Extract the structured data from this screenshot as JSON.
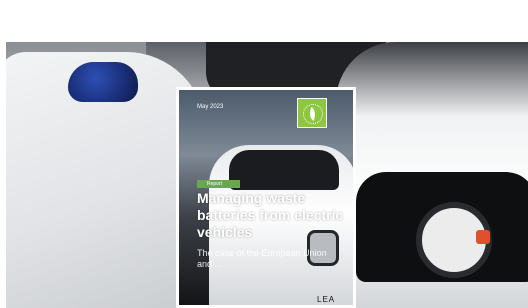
{
  "cover": {
    "date": "May 2023",
    "tag": "Report",
    "title": "Managing waste batteries from electric vehicles",
    "subtitle": "The case of the European Union and ...",
    "plate_text": "LEA"
  }
}
